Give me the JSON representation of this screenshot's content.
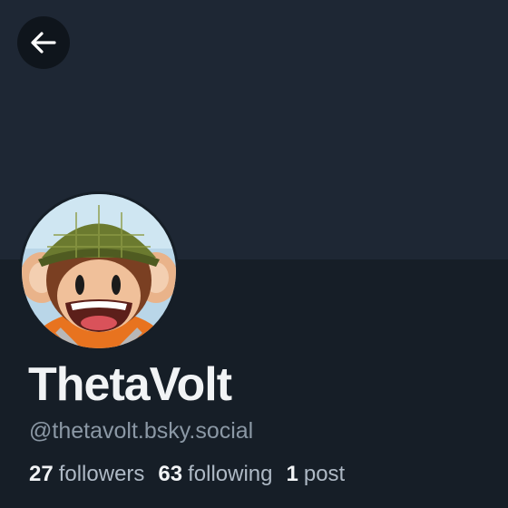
{
  "header": {
    "back_icon": "arrow-left-icon"
  },
  "profile": {
    "display_name": "ThetaVolt",
    "handle": "@thetavolt.bsky.social",
    "avatar": "cartoon-monkey-with-helmet"
  },
  "stats": {
    "followers_count": "27",
    "followers_label": "followers",
    "following_count": "63",
    "following_label": "following",
    "posts_count": "1",
    "posts_label": "post"
  },
  "colors": {
    "banner": "#1e2734",
    "background": "#161e27",
    "text_primary": "#f1f3f5",
    "text_secondary": "#8b98a5"
  }
}
